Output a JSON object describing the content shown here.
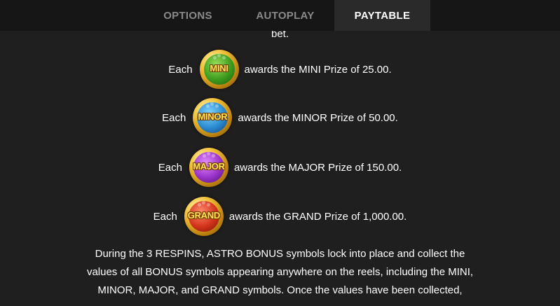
{
  "tabs": {
    "options": "OPTIONS",
    "autoplay": "AUTOPLAY",
    "paytable": "PAYTABLE"
  },
  "paytable": {
    "bet_text": "bet.",
    "prizes": [
      {
        "each": "Each",
        "coin_label": "MINI",
        "desc": "awards the MINI Prize of 25.00."
      },
      {
        "each": "Each",
        "coin_label": "MINOR",
        "desc": "awards the MINOR Prize of 50.00."
      },
      {
        "each": "Each",
        "coin_label": "MAJOR",
        "desc": "awards the MAJOR Prize of 150.00."
      },
      {
        "each": "Each",
        "coin_label": "GRAND",
        "desc": "awards the GRAND Prize of 1,000.00."
      }
    ],
    "lines": [
      "During the 3 RESPINS, ASTRO BONUS symbols lock into place and collect the",
      "values of all BONUS symbols appearing anywhere on the reels, including the MINI,",
      "MINOR, MAJOR, and GRAND symbols. Once the values have been collected,"
    ]
  },
  "colors": {
    "background": "#1f1f1f",
    "tabbar": "#161616",
    "active_tab": "#2a2a2a",
    "inactive_tab_text": "#8a8a8a"
  }
}
